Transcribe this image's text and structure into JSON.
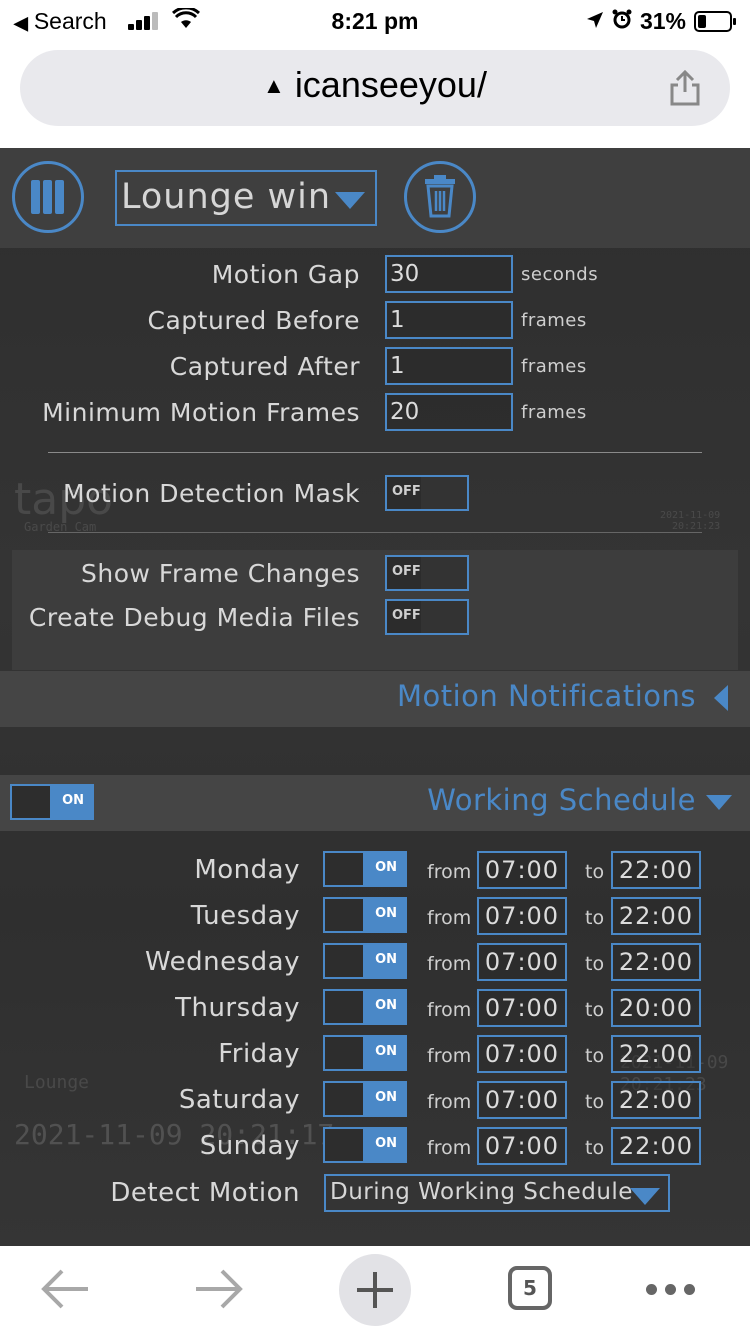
{
  "status_bar": {
    "back_label": "Search",
    "time": "8:21 pm",
    "battery": "31%"
  },
  "browser": {
    "url": "icanseeyou/",
    "tab_count": "5"
  },
  "camera": {
    "selected": "Lounge win"
  },
  "settings": [
    {
      "label": "Motion Gap",
      "value": "30",
      "unit": "seconds"
    },
    {
      "label": "Captured Before",
      "value": "1",
      "unit": "frames"
    },
    {
      "label": "Captured After",
      "value": "1",
      "unit": "frames"
    },
    {
      "label": "Minimum Motion Frames",
      "value": "20",
      "unit": "frames"
    }
  ],
  "mask": {
    "label": "Motion Detection Mask",
    "state": "OFF"
  },
  "debug": [
    {
      "label": "Show Frame Changes",
      "state": "OFF"
    },
    {
      "label": "Create Debug Media Files",
      "state": "OFF"
    }
  ],
  "notifications": {
    "title": "Motion Notifications"
  },
  "schedule": {
    "toggle": "ON",
    "title": "Working Schedule",
    "from_label": "from",
    "to_label": "to",
    "days": [
      {
        "name": "Monday",
        "state": "ON",
        "from": "07:00",
        "to": "22:00"
      },
      {
        "name": "Tuesday",
        "state": "ON",
        "from": "07:00",
        "to": "22:00"
      },
      {
        "name": "Wednesday",
        "state": "ON",
        "from": "07:00",
        "to": "22:00"
      },
      {
        "name": "Thursday",
        "state": "ON",
        "from": "07:00",
        "to": "20:00"
      },
      {
        "name": "Friday",
        "state": "ON",
        "from": "07:00",
        "to": "22:00"
      },
      {
        "name": "Saturday",
        "state": "ON",
        "from": "07:00",
        "to": "22:00"
      },
      {
        "name": "Sunday",
        "state": "ON",
        "from": "07:00",
        "to": "22:00"
      }
    ],
    "detect_label": "Detect Motion",
    "detect_value": "During Working Schedule"
  },
  "camera_overlay": {
    "brand": "tapo",
    "garden_name": "Garden Cam",
    "lounge_name": "Lounge",
    "timestamp": "2021-11-09 20:21:17",
    "small_date": "2021-11-09",
    "small_time": "20:21:23"
  },
  "colors": {
    "accent": "#4a88c7",
    "panel": "#3f3f3f"
  },
  "icons": {
    "menu": "pause-bars-icon",
    "trash": "trash-icon",
    "share": "share-icon",
    "back": "arrow-left-icon",
    "forward": "arrow-right-icon"
  }
}
